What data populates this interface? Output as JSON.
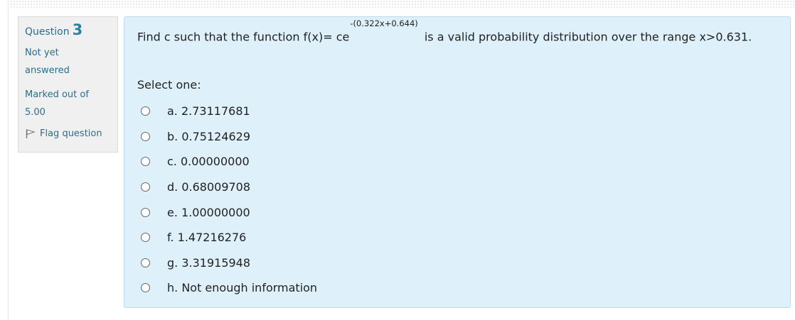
{
  "question": {
    "label": "Question",
    "number": "3",
    "state": "Not yet answered",
    "grade": "Marked out of 5.00",
    "flag_label": "Flag question"
  },
  "content": {
    "text_before": "Find c such that the function f(x)= ce",
    "exponent": "-(0.322x+0.644)",
    "text_after": "is a valid probability distribution over the range x>0.631.",
    "prompt": "Select one:",
    "options": [
      {
        "label": "a. 2.73117681"
      },
      {
        "label": "b. 0.75124629"
      },
      {
        "label": "c. 0.00000000"
      },
      {
        "label": "d. 0.68009708"
      },
      {
        "label": "e. 1.00000000"
      },
      {
        "label": "f. 1.47216276"
      },
      {
        "label": "g. 3.31915948"
      },
      {
        "label": "h. Not enough information"
      }
    ]
  },
  "colors": {
    "info_bg": "#f0f0f0",
    "content_bg": "#def0fa",
    "link": "#2a6e8a"
  },
  "icons": {
    "flag": "flag-icon"
  }
}
